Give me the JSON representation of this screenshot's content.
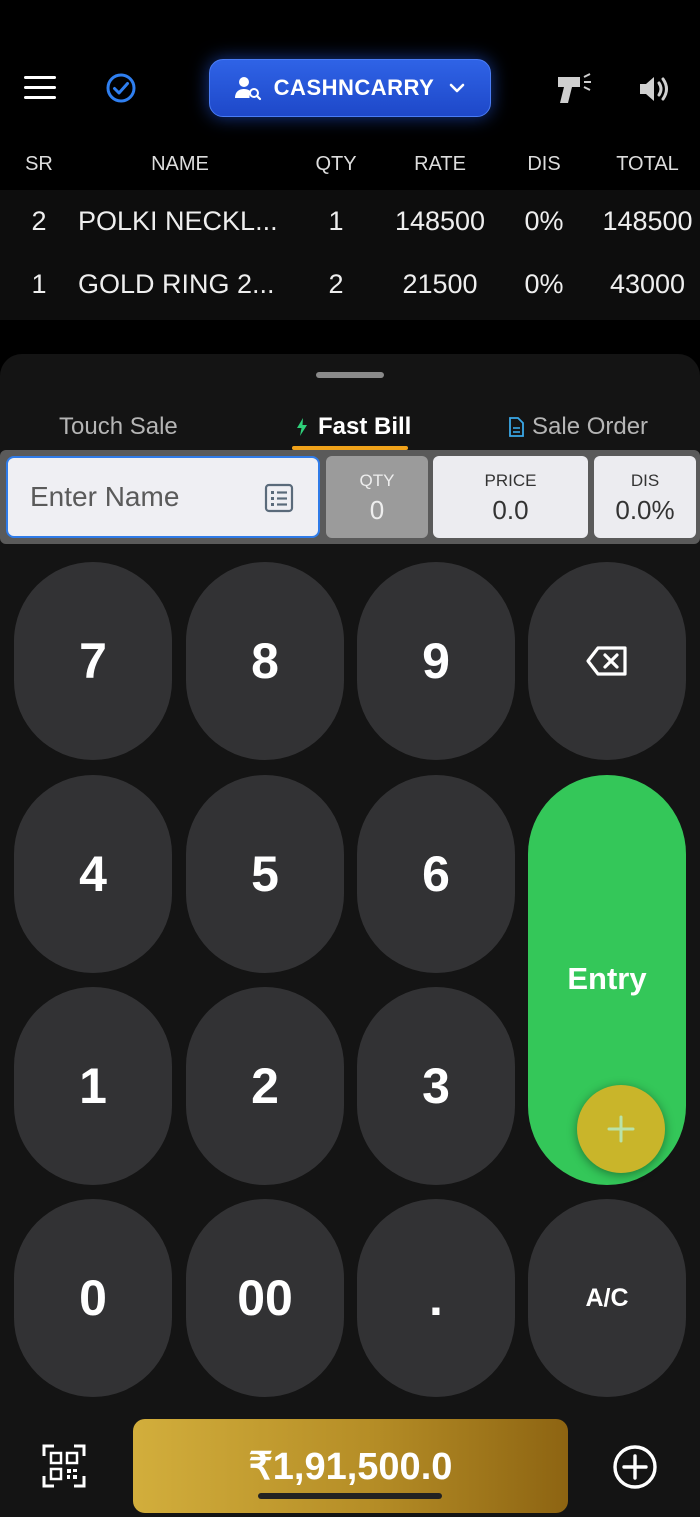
{
  "header": {
    "customer_label": "CASHNCARRY",
    "icons": [
      "menu-icon",
      "check-circle-icon",
      "user-search-icon",
      "chevron-down-icon",
      "barcode-scanner-icon",
      "speaker-icon"
    ],
    "accent_color": "#2f63e6"
  },
  "table": {
    "headers": {
      "sr": "SR",
      "name": "NAME",
      "qty": "QTY",
      "rate": "RATE",
      "dis": "DIS",
      "total": "TOTAL"
    },
    "rows": [
      {
        "sr": "2",
        "name": "POLKI NECKL...",
        "qty": "1",
        "rate": "148500",
        "dis": "0%",
        "total": "148500"
      },
      {
        "sr": "1",
        "name": "GOLD RING 2...",
        "qty": "2",
        "rate": "21500",
        "dis": "0%",
        "total": "43000"
      }
    ]
  },
  "tabs": {
    "touch_sale": "Touch Sale",
    "fast_bill": "Fast Bill",
    "sale_order": "Sale Order",
    "active": "Fast Bill",
    "active_color": "#f0a21a"
  },
  "fields": {
    "name_placeholder": "Enter Name",
    "qty_label": "QTY",
    "qty_value": "0",
    "price_label": "PRICE",
    "price_value": "0.0",
    "dis_label": "DIS",
    "dis_value": "0.0%"
  },
  "keypad": {
    "k7": "7",
    "k8": "8",
    "k9": "9",
    "k4": "4",
    "k5": "5",
    "k6": "6",
    "k1": "1",
    "k2": "2",
    "k3": "3",
    "k0": "0",
    "k00": "00",
    "kdot": ".",
    "ac": "A/C",
    "entry": "Entry",
    "entry_color": "#34c759"
  },
  "footer": {
    "total": "₹1,91,500.0",
    "icons": [
      "qr-code-icon",
      "add-circle-icon"
    ]
  }
}
